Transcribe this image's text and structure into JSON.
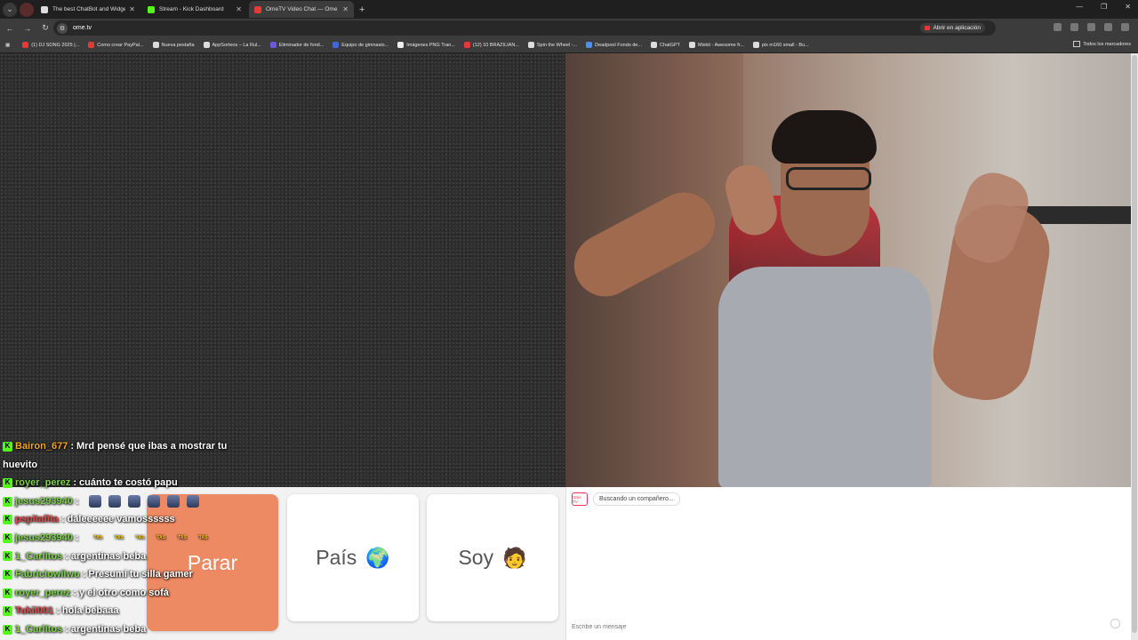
{
  "browser": {
    "tabs": [
      {
        "title": "The best ChatBot and Widgets",
        "active": false,
        "favicon_color": "#dddddd"
      },
      {
        "title": "Stream - Kick Dashboard",
        "active": false,
        "favicon_color": "#53fc18"
      },
      {
        "title": "OmeTV Video Chat — Ome",
        "active": true,
        "favicon_color": "#e53935"
      }
    ],
    "url": "ome.tv",
    "open_app_label": "Abrir en aplicación",
    "bookmarks": [
      {
        "label": "(1) DJ SONG 2025 |...",
        "color": "#e53935"
      },
      {
        "label": "Como crear PayPal...",
        "color": "#e53935"
      },
      {
        "label": "Nueva pestaña",
        "color": "#dddddd"
      },
      {
        "label": "AppSorteos – La Rul...",
        "color": "#dddddd"
      },
      {
        "label": "Eliminador de fond...",
        "color": "#6b5bd6"
      },
      {
        "label": "Equipo de gimnasio...",
        "color": "#3b6ad1"
      },
      {
        "label": "Imágenes PNG Tran...",
        "color": "#eeeeee"
      },
      {
        "label": "(12) 10 BRAZILIAN...",
        "color": "#e53935"
      },
      {
        "label": "Spin the Wheel -...",
        "color": "#dddddd"
      },
      {
        "label": "Deadpool Fondo de...",
        "color": "#4c8df6"
      },
      {
        "label": "ChatGPT",
        "color": "#dddddd"
      },
      {
        "label": "Mixkit - Awesome fr...",
        "color": "#dddddd"
      },
      {
        "label": "pix m160 small - Bu...",
        "color": "#dddddd"
      }
    ],
    "all_bookmarks_label": "Todos los marcadores"
  },
  "buttons": {
    "stop_label": "Parar",
    "country_label": "País",
    "country_emoji": "🌍",
    "gender_label": "Soy",
    "gender_emoji": "🧑"
  },
  "chat_panel": {
    "status_text": "Buscando un compañero...",
    "logo_text": "Ome TV",
    "input_placeholder": "Escribe un mensaje"
  },
  "kick_chat": {
    "messages": [
      {
        "user": "Bairon_677",
        "text": "Mrd pensé que ibas a mostrar tu",
        "user_color": "#f5a623"
      },
      {
        "user": "",
        "text": "huevito",
        "user_color": ""
      },
      {
        "user": "royer_perez",
        "text": "cuánto te costó papu",
        "user_color": "#7cd24b"
      },
      {
        "user": "jesus293940",
        "text": "",
        "user_color": "#7cd24b"
      },
      {
        "user": "pspitafita",
        "text": "daleeeeee vamossssss",
        "user_color": "#e24a4a"
      },
      {
        "user": "jesus293940",
        "text": "",
        "user_color": "#7cd24b"
      },
      {
        "user": "1_Carlitos",
        "text": "argentinas beba",
        "user_color": "#7cd24b"
      },
      {
        "user": "Fabriciowilwu",
        "text": "Presumí tu silla gamer",
        "user_color": "#7cd24b"
      },
      {
        "user": "royer_perez",
        "text": "y el otro como sofá",
        "user_color": "#7cd24b"
      },
      {
        "user": "Tukii001",
        "text": "hola bebaaa",
        "user_color": "#e24a4a"
      },
      {
        "user": "1_Carlitos",
        "text": "argentinas beba",
        "user_color": "#7cd24b"
      }
    ],
    "emote_small_label": "TAS"
  },
  "colors": {
    "stop_button": "#ee8a63",
    "kick_green": "#53fc18",
    "browser_chrome": "#3c3c3c"
  }
}
